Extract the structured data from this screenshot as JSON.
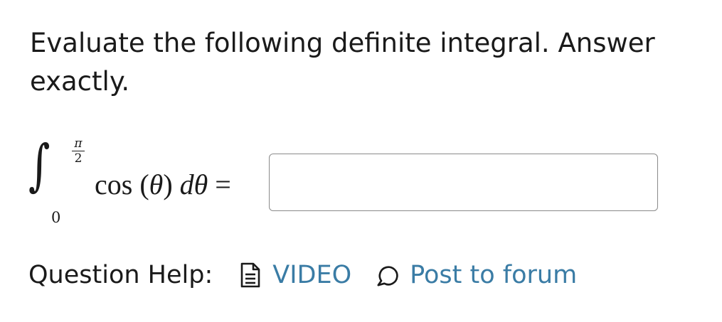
{
  "question": {
    "prompt": "Evaluate the following definite integral. Answer exactly."
  },
  "integral": {
    "upper_limit_numerator": "π",
    "upper_limit_denominator": "2",
    "lower_limit": "0",
    "integrand_func": "cos",
    "integrand_arg": "θ",
    "differential_d": "d",
    "differential_var": "θ",
    "equals": "="
  },
  "answer_input": {
    "value": "",
    "placeholder": ""
  },
  "help": {
    "label": "Question Help:",
    "links": [
      {
        "label": "VIDEO",
        "icon": "document-icon"
      },
      {
        "label": "Post to forum",
        "icon": "speech-bubble-icon"
      }
    ]
  },
  "colors": {
    "text": "#1a1a1a",
    "link": "#3a7ca5",
    "input_border": "#8a8a8a",
    "background": "#ffffff"
  }
}
